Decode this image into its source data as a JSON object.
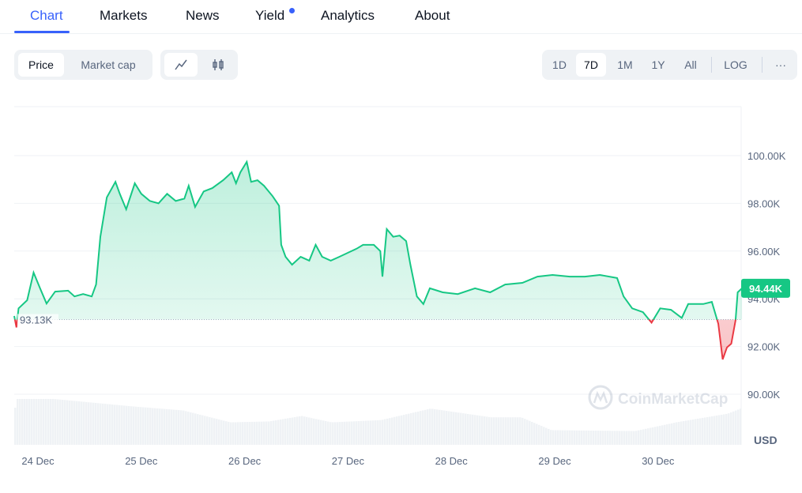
{
  "tabs": [
    {
      "label": "Chart",
      "active": true
    },
    {
      "label": "Markets"
    },
    {
      "label": "News"
    },
    {
      "label": "Yield",
      "badge_dot": true
    },
    {
      "label": "Analytics"
    },
    {
      "label": "About"
    }
  ],
  "toolbar": {
    "metric_options": [
      "Price",
      "Market cap"
    ],
    "metric_selected": "Price",
    "chart_types": [
      {
        "icon": "line-chart-icon",
        "selected": true
      },
      {
        "icon": "candlestick-icon"
      }
    ],
    "ranges": [
      "1D",
      "7D",
      "1M",
      "1Y",
      "All"
    ],
    "range_selected": "7D",
    "log_label": "LOG",
    "more_label": "···"
  },
  "colors": {
    "accent": "#3861fb",
    "up": "#16c784",
    "down": "#ea3943"
  },
  "watermark": "CoinMarketCap",
  "chart_data": {
    "type": "area",
    "y_ticks": [
      "90.00K",
      "92.00K",
      "94.00K",
      "96.00K",
      "98.00K",
      "100.00K"
    ],
    "y_tick_values": [
      90,
      92,
      94,
      96,
      98,
      100
    ],
    "ylim": [
      89.0,
      102.0
    ],
    "y_unit": "USD",
    "x_ticks": [
      "24 Dec",
      "25 Dec",
      "26 Dec",
      "27 Dec",
      "28 Dec",
      "29 Dec",
      "30 Dec"
    ],
    "baseline": {
      "value": 93.13,
      "label": "93.13K"
    },
    "current": {
      "value": 94.44,
      "label": "94.44K"
    },
    "grid": true,
    "price_series": [
      [
        "23 Dec 18:30",
        93.28
      ],
      [
        "23 Dec 19:00",
        92.8
      ],
      [
        "23 Dec 19:30",
        93.6
      ],
      [
        "23 Dec 21:30",
        93.94
      ],
      [
        "23 Dec 23:00",
        95.1
      ],
      [
        "24 Dec 00:30",
        94.44
      ],
      [
        "24 Dec 02:00",
        93.8
      ],
      [
        "24 Dec 04:00",
        94.3
      ],
      [
        "24 Dec 07:00",
        94.34
      ],
      [
        "24 Dec 08:30",
        94.1
      ],
      [
        "24 Dec 10:30",
        94.2
      ],
      [
        "24 Dec 12:30",
        94.1
      ],
      [
        "24 Dec 13:30",
        94.6
      ],
      [
        "24 Dec 14:30",
        96.6
      ],
      [
        "24 Dec 16:00",
        98.25
      ],
      [
        "24 Dec 18:00",
        98.9
      ],
      [
        "24 Dec 19:00",
        98.4
      ],
      [
        "24 Dec 20:30",
        97.75
      ],
      [
        "24 Dec 22:30",
        98.84
      ],
      [
        "25 Dec 00:00",
        98.4
      ],
      [
        "25 Dec 02:00",
        98.1
      ],
      [
        "25 Dec 04:00",
        98.0
      ],
      [
        "25 Dec 06:00",
        98.4
      ],
      [
        "25 Dec 08:00",
        98.1
      ],
      [
        "25 Dec 10:00",
        98.2
      ],
      [
        "25 Dec 11:00",
        98.74
      ],
      [
        "25 Dec 12:30",
        97.85
      ],
      [
        "25 Dec 14:30",
        98.5
      ],
      [
        "25 Dec 16:30",
        98.64
      ],
      [
        "25 Dec 19:00",
        98.97
      ],
      [
        "25 Dec 21:00",
        99.3
      ],
      [
        "25 Dec 22:00",
        98.84
      ],
      [
        "25 Dec 23:00",
        99.3
      ],
      [
        "26 Dec 00:30",
        99.74
      ],
      [
        "26 Dec 01:30",
        98.9
      ],
      [
        "26 Dec 03:00",
        98.97
      ],
      [
        "26 Dec 04:30",
        98.74
      ],
      [
        "26 Dec 06:30",
        98.3
      ],
      [
        "26 Dec 08:00",
        97.9
      ],
      [
        "26 Dec 08:30",
        96.26
      ],
      [
        "26 Dec 09:30",
        95.76
      ],
      [
        "26 Dec 11:00",
        95.43
      ],
      [
        "26 Dec 13:00",
        95.76
      ],
      [
        "26 Dec 15:00",
        95.6
      ],
      [
        "26 Dec 16:30",
        96.26
      ],
      [
        "26 Dec 18:00",
        95.76
      ],
      [
        "26 Dec 20:00",
        95.6
      ],
      [
        "26 Dec 22:00",
        95.76
      ],
      [
        "27 Dec 00:00",
        95.93
      ],
      [
        "27 Dec 02:00",
        96.1
      ],
      [
        "27 Dec 03:30",
        96.26
      ],
      [
        "27 Dec 06:00",
        96.26
      ],
      [
        "27 Dec 07:30",
        96.0
      ],
      [
        "27 Dec 08:00",
        94.93
      ],
      [
        "27 Dec 09:00",
        96.92
      ],
      [
        "27 Dec 10:30",
        96.6
      ],
      [
        "27 Dec 12:00",
        96.65
      ],
      [
        "27 Dec 13:30",
        96.42
      ],
      [
        "27 Dec 14:30",
        95.43
      ],
      [
        "27 Dec 16:00",
        94.1
      ],
      [
        "27 Dec 17:30",
        93.78
      ],
      [
        "27 Dec 19:00",
        94.44
      ],
      [
        "27 Dec 22:00",
        94.27
      ],
      [
        "28 Dec 01:30",
        94.2
      ],
      [
        "28 Dec 05:30",
        94.44
      ],
      [
        "28 Dec 09:00",
        94.27
      ],
      [
        "28 Dec 12:30",
        94.6
      ],
      [
        "28 Dec 16:30",
        94.67
      ],
      [
        "28 Dec 20:00",
        94.93
      ],
      [
        "28 Dec 23:30",
        95.0
      ],
      [
        "29 Dec 03:30",
        94.93
      ],
      [
        "29 Dec 07:00",
        94.93
      ],
      [
        "29 Dec 10:30",
        95.0
      ],
      [
        "29 Dec 14:30",
        94.87
      ],
      [
        "29 Dec 16:00",
        94.1
      ],
      [
        "29 Dec 18:00",
        93.6
      ],
      [
        "29 Dec 20:30",
        93.44
      ],
      [
        "29 Dec 22:30",
        93.0
      ],
      [
        "30 Dec 00:30",
        93.6
      ],
      [
        "30 Dec 03:00",
        93.54
      ],
      [
        "30 Dec 05:30",
        93.2
      ],
      [
        "30 Dec 07:00",
        93.78
      ],
      [
        "30 Dec 10:30",
        93.78
      ],
      [
        "30 Dec 12:30",
        93.87
      ],
      [
        "30 Dec 14:00",
        92.95
      ],
      [
        "30 Dec 15:00",
        91.46
      ],
      [
        "30 Dec 16:00",
        91.96
      ],
      [
        "30 Dec 17:00",
        92.12
      ],
      [
        "30 Dec 18:00",
        93.1
      ],
      [
        "30 Dec 18:30",
        94.27
      ],
      [
        "30 Dec 19:30",
        94.44
      ]
    ],
    "volume_relative": [
      [
        "23 Dec 18:30",
        1.0
      ],
      [
        "24 Dec 03:30",
        1.0
      ],
      [
        "24 Dec 21:30",
        0.84
      ],
      [
        "25 Dec 09:30",
        0.75
      ],
      [
        "25 Dec 20:30",
        0.49
      ],
      [
        "26 Dec 05:30",
        0.51
      ],
      [
        "26 Dec 13:00",
        0.63
      ],
      [
        "26 Dec 20:00",
        0.49
      ],
      [
        "27 Dec 07:30",
        0.54
      ],
      [
        "27 Dec 19:00",
        0.79
      ],
      [
        "28 Dec 09:00",
        0.6
      ],
      [
        "28 Dec 16:00",
        0.6
      ],
      [
        "28 Dec 23:00",
        0.32
      ],
      [
        "29 Dec 18:30",
        0.3
      ],
      [
        "30 Dec 04:00",
        0.49
      ],
      [
        "30 Dec 16:00",
        0.68
      ],
      [
        "30 Dec 19:30",
        0.81
      ]
    ]
  }
}
